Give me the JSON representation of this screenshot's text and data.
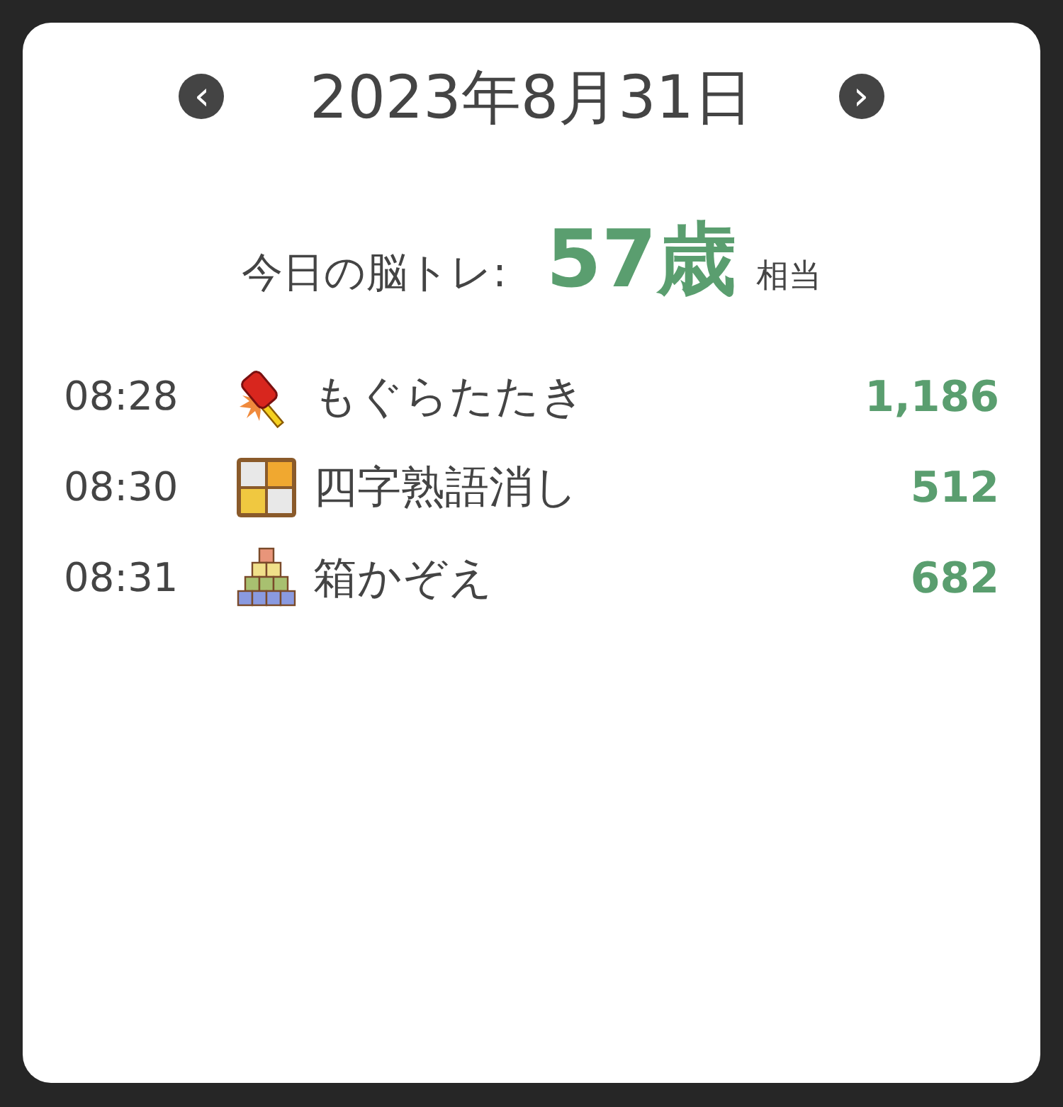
{
  "header": {
    "prev": "‹",
    "date": "2023年8月31日",
    "next": "›"
  },
  "summary": {
    "label": "今日の脳トレ:",
    "age": "57歳",
    "suffix": "相当"
  },
  "entries": [
    {
      "time": "08:28",
      "kind": "hammer",
      "name": "もぐらたたき",
      "score": "1,186"
    },
    {
      "time": "08:30",
      "kind": "tiles",
      "name": "四字熟語消し",
      "score": "512"
    },
    {
      "time": "08:31",
      "kind": "blocks",
      "name": "箱かぞえ",
      "score": "682"
    }
  ]
}
